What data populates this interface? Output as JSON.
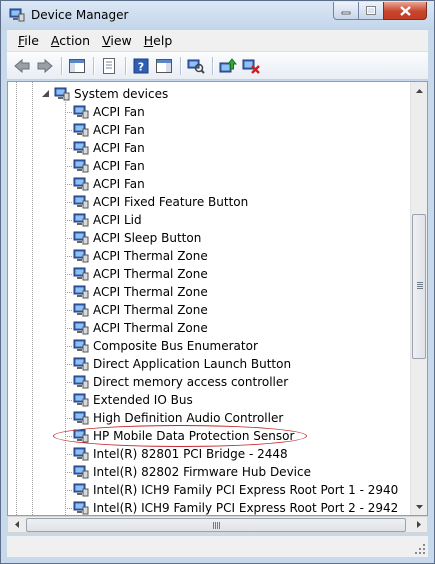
{
  "window": {
    "title": "Device Manager",
    "caption_buttons": [
      "minimize-icon",
      "maximize-icon",
      "close-icon"
    ]
  },
  "menu": [
    {
      "label": "File",
      "accel": "F"
    },
    {
      "label": "Action",
      "accel": "A"
    },
    {
      "label": "View",
      "accel": "V"
    },
    {
      "label": "Help",
      "accel": "H"
    }
  ],
  "toolbar": [
    "back-icon",
    "forward-icon",
    "show-hide-console-tree-icon",
    "properties-icon",
    "help-icon",
    "action-pane-icon",
    "scan-hardware-icon",
    "update-driver-icon",
    "uninstall-icon"
  ],
  "tree": {
    "category": {
      "label": "System devices",
      "expanded": true
    },
    "devices": [
      "ACPI Fan",
      "ACPI Fan",
      "ACPI Fan",
      "ACPI Fan",
      "ACPI Fan",
      "ACPI Fixed Feature Button",
      "ACPI Lid",
      "ACPI Sleep Button",
      "ACPI Thermal Zone",
      "ACPI Thermal Zone",
      "ACPI Thermal Zone",
      "ACPI Thermal Zone",
      "ACPI Thermal Zone",
      "Composite Bus Enumerator",
      "Direct Application Launch Button",
      "Direct memory access controller",
      "Extended IO Bus",
      "High Definition Audio Controller",
      "HP Mobile Data Protection Sensor",
      "Intel(R) 82801 PCI Bridge - 2448",
      "Intel(R) 82802 Firmware Hub Device",
      "Intel(R) ICH9 Family PCI Express Root Port 1 - 2940",
      "Intel(R) ICH9 Family PCI Express Root Port 2 - 2942"
    ],
    "highlighted": "HP Mobile Data Protection Sensor"
  },
  "colors": {
    "highlight_ellipse": "#c1272d",
    "title_bar": "#c3d5ea"
  }
}
